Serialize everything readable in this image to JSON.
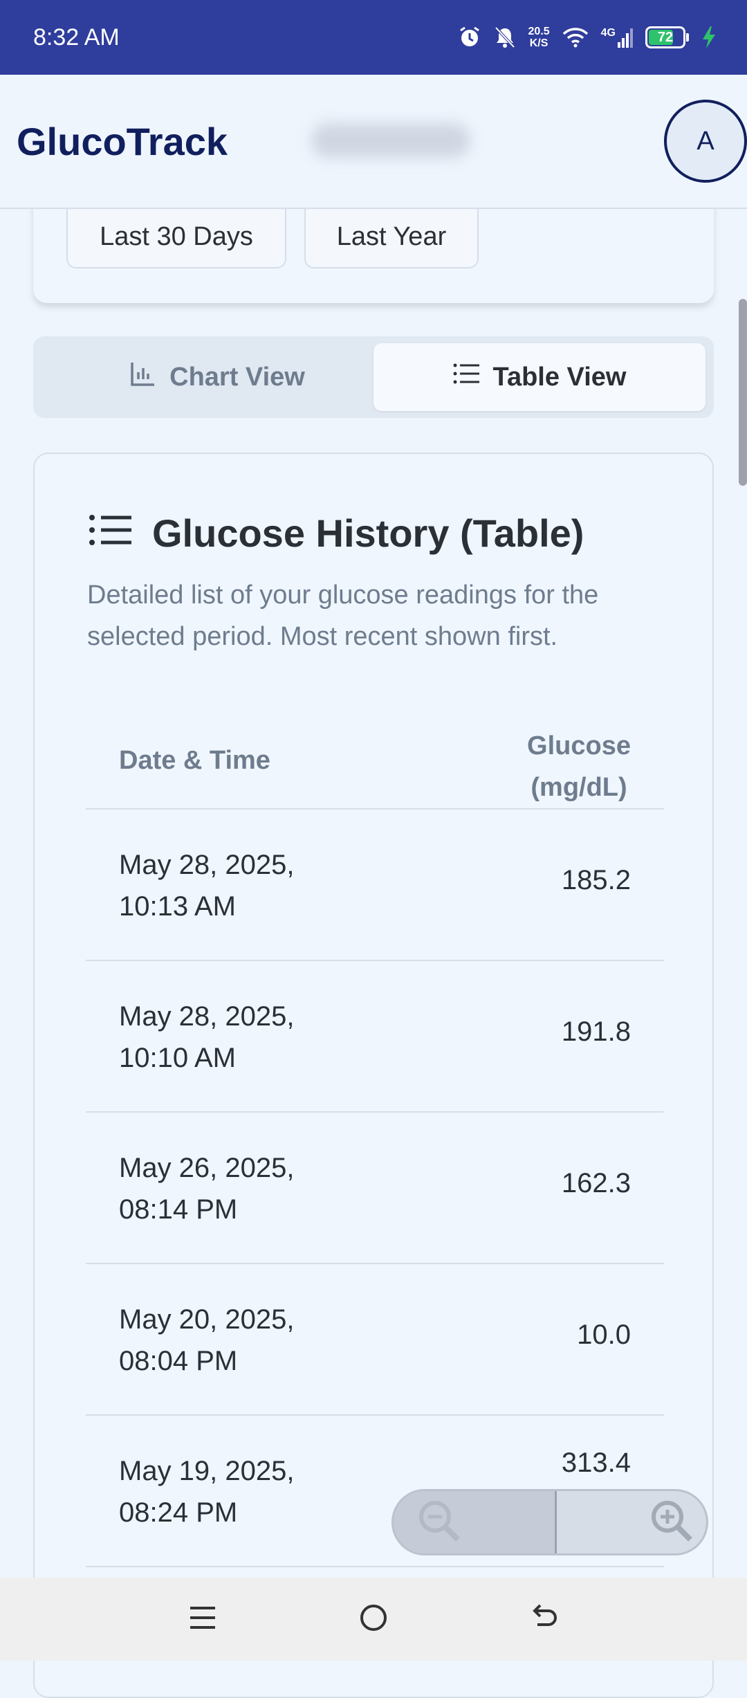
{
  "status_bar": {
    "time": "8:32 AM",
    "net_speed_value": "20.5",
    "net_speed_unit": "K/S",
    "network": "4G",
    "battery": "72",
    "battery_level": 0.72
  },
  "header": {
    "title": "GlucoTrack",
    "avatar_letter": "A"
  },
  "range_buttons": [
    {
      "label": "Last 30 Days"
    },
    {
      "label": "Last Year"
    }
  ],
  "view_toggle": {
    "chart_label": "Chart View",
    "table_label": "Table View",
    "active": "table"
  },
  "table_card": {
    "title": "Glucose History (Table)",
    "description": "Detailed list of your glucose readings for the selected period. Most recent shown first.",
    "columns": {
      "date": "Date & Time",
      "glucose_line1": "Glucose",
      "glucose_line2": "(mg/dL)"
    },
    "rows": [
      {
        "date_line1": "May 28, 2025,",
        "date_line2": "10:13 AM",
        "value": "185.2"
      },
      {
        "date_line1": "May 28, 2025,",
        "date_line2": "10:10 AM",
        "value": "191.8"
      },
      {
        "date_line1": "May 26, 2025,",
        "date_line2": "08:14 PM",
        "value": "162.3"
      },
      {
        "date_line1": "May 20, 2025,",
        "date_line2": "08:04 PM",
        "value": "10.0"
      },
      {
        "date_line1": "May 19, 2025,",
        "date_line2": "08:24 PM",
        "value": "313.4"
      }
    ]
  },
  "colors": {
    "status_bar": "#2f3d9c",
    "brand": "#111f5e",
    "background": "#eef5fd",
    "muted_text": "#6e7c8e"
  },
  "icons": {
    "chart_view": "bar-chart-icon",
    "table_view": "list-icon",
    "card_title": "list-icon",
    "zoom_out": "zoom-out-icon",
    "zoom_in": "zoom-in-icon"
  }
}
